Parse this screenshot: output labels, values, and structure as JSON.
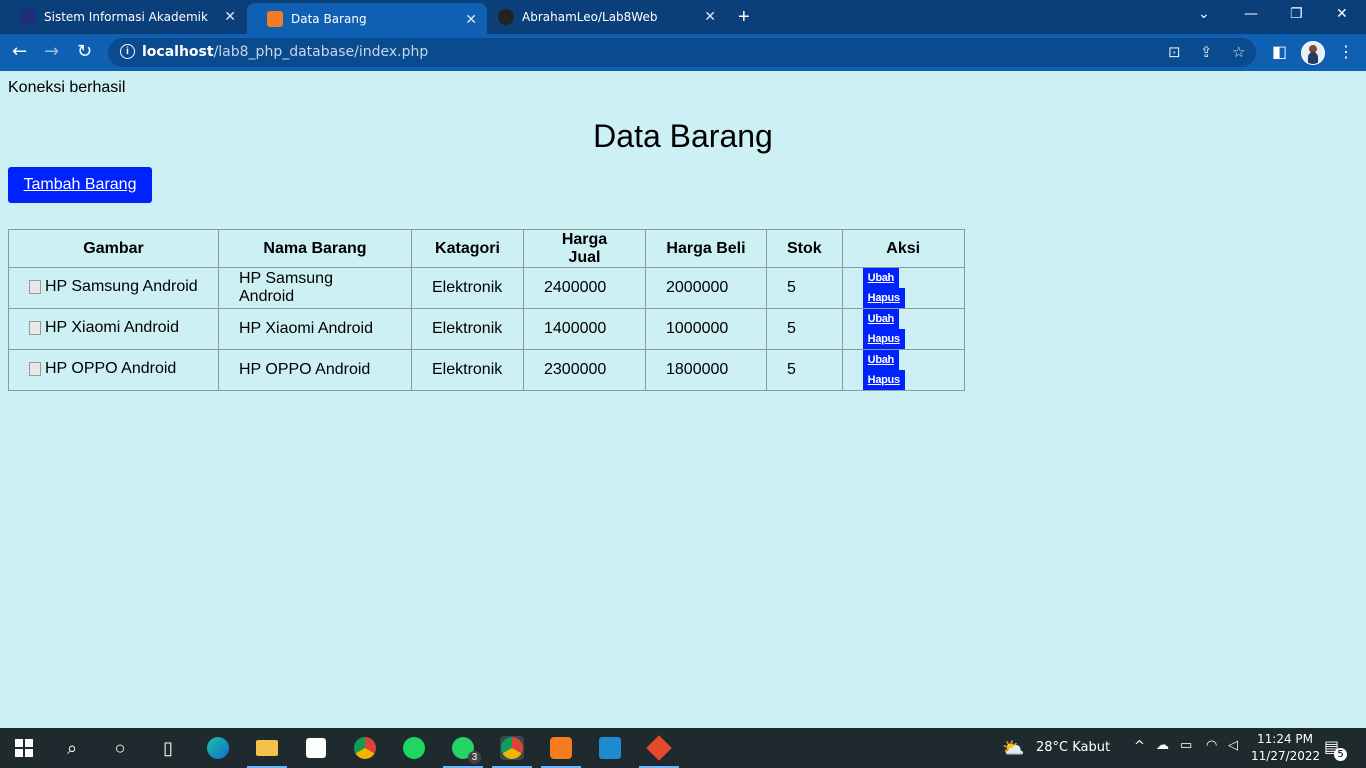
{
  "browser": {
    "tabs": [
      {
        "title": "Sistem Informasi Akademik",
        "active": false
      },
      {
        "title": "Data Barang",
        "active": true
      },
      {
        "title": "AbrahamLeo/Lab8Web",
        "active": false
      }
    ],
    "url_host": "localhost",
    "url_path": "/lab8_php_database/index.php"
  },
  "page": {
    "status": "Koneksi berhasil",
    "title": "Data Barang",
    "add_button": "Tambah Barang"
  },
  "table": {
    "headers": [
      "Gambar",
      "Nama Barang",
      "Katagori",
      "Harga Jual",
      "Harga Beli",
      "Stok",
      "Aksi"
    ],
    "rows": [
      {
        "gambar": "HP Samsung Android",
        "nama": "HP Samsung Android",
        "kategori": "Elektronik",
        "harga_jual": "2400000",
        "harga_beli": "2000000",
        "stok": "5"
      },
      {
        "gambar": "HP Xiaomi Android",
        "nama": "HP Xiaomi Android",
        "kategori": "Elektronik",
        "harga_jual": "1400000",
        "harga_beli": "1000000",
        "stok": "5"
      },
      {
        "gambar": "HP OPPO Android",
        "nama": "HP OPPO Android",
        "kategori": "Elektronik",
        "harga_jual": "2300000",
        "harga_beli": "1800000",
        "stok": "5"
      }
    ],
    "edit_label": "Ubah",
    "delete_label": "Hapus"
  },
  "taskbar": {
    "weather": "28°C  Kabut",
    "time": "11:24 PM",
    "date": "11/27/2022",
    "whatsapp_badge": "3",
    "notification_badge": "5"
  },
  "colors": {
    "page_bg": "#cdf0f4",
    "button_blue": "#0022ff",
    "browser_frame": "#0b3f7a"
  }
}
